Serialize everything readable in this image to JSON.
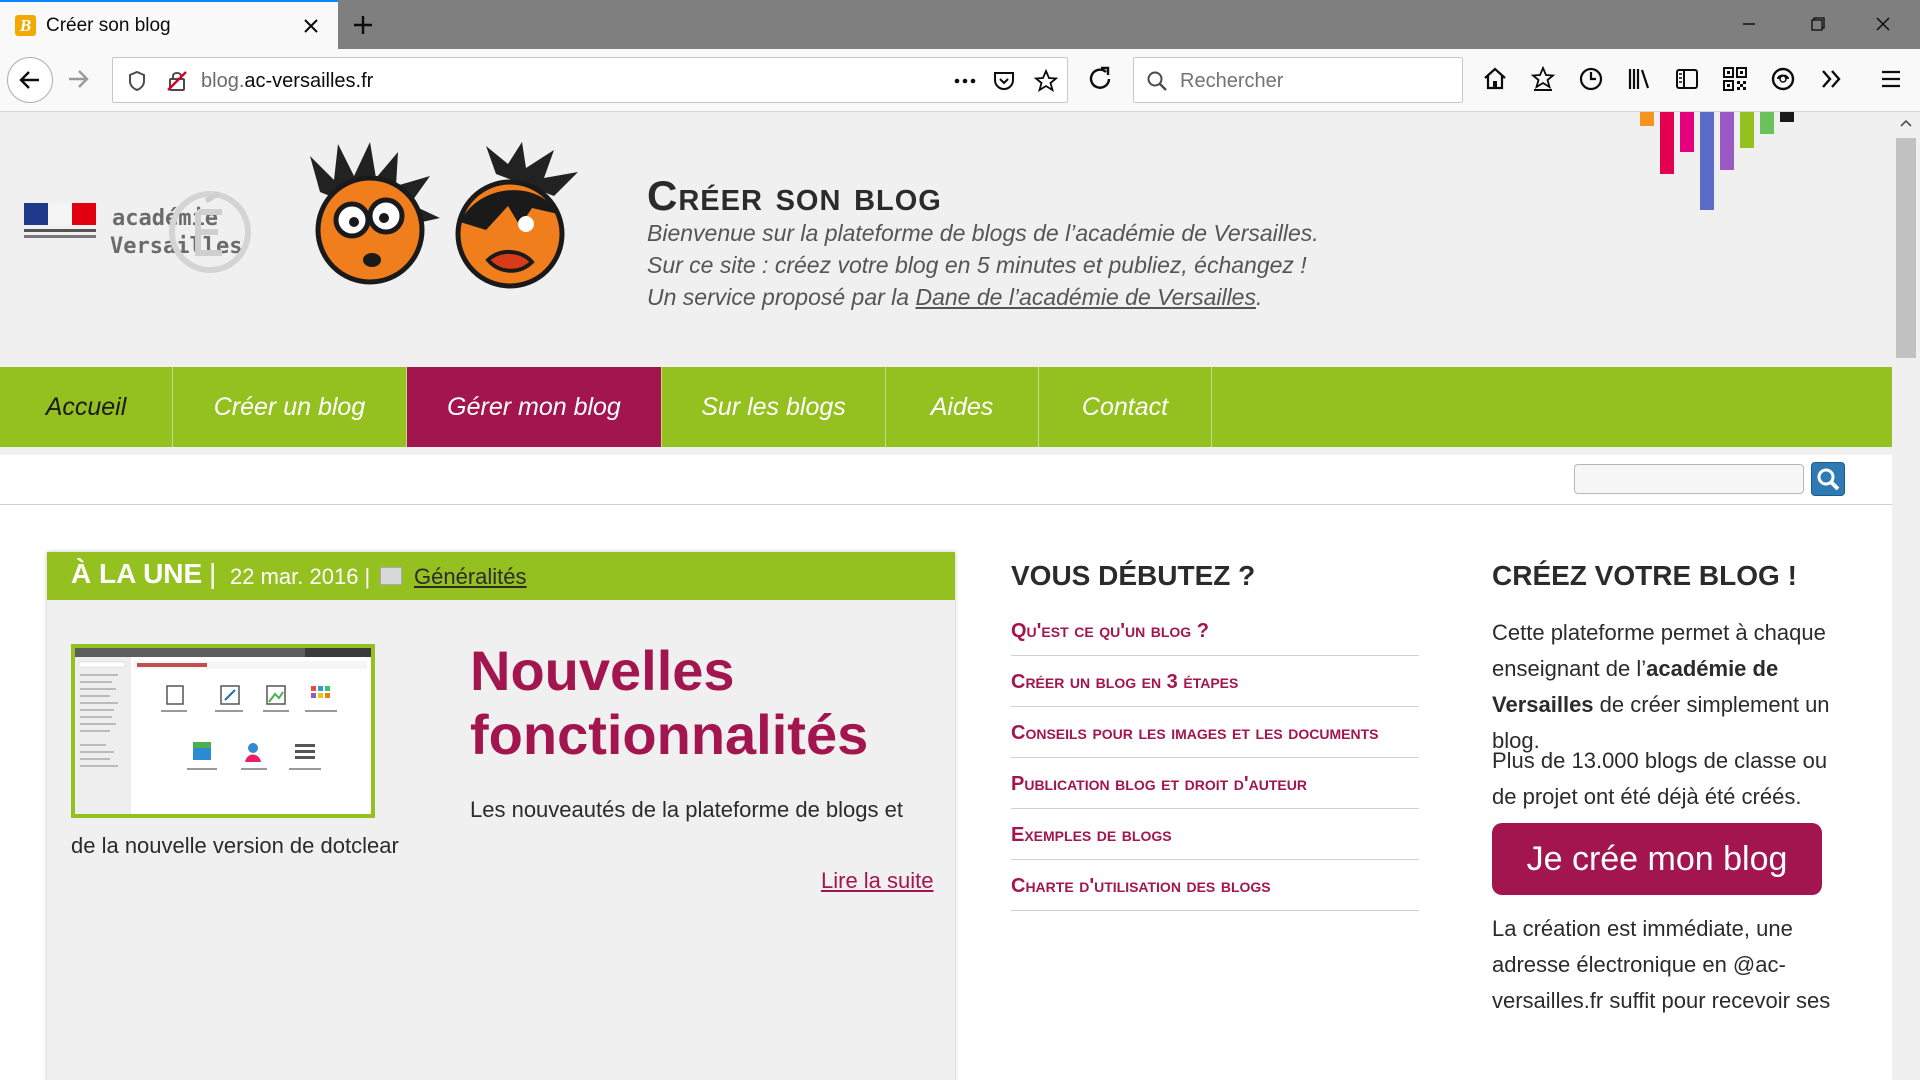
{
  "browser": {
    "tab_title": "Créer son blog",
    "favicon_letter": "B",
    "url_prefix": "blog.",
    "url_domain": "ac-versailles.fr",
    "search_placeholder": "Rechercher",
    "accent": "#0a84ff"
  },
  "header": {
    "logo_text_1": "académie",
    "logo_text_2": "Versailles",
    "title": "Créer son blog",
    "tagline_1": "Bienvenue sur la plateforme de blogs de l’académie de Versailles.",
    "tagline_2": "Sur ce site : créez votre blog en 5 minutes et publiez, échangez !",
    "tagline_3_prefix": "Un service proposé par la ",
    "tagline_3_link": "Dane de l’académie de Versailles",
    "tagline_3_suffix": "."
  },
  "menu": {
    "items": [
      {
        "label": "Accueil"
      },
      {
        "label": "Créer un blog"
      },
      {
        "label": "Gérer mon blog"
      },
      {
        "label": "Sur les blogs"
      },
      {
        "label": "Aides"
      },
      {
        "label": "Contact"
      }
    ],
    "active": "Gérer mon blog"
  },
  "article": {
    "section": "À LA UNE",
    "separator": "|",
    "date": "22 mar. 2016 |",
    "category": "Généralités",
    "title": "Nouvelles fonctionnalités",
    "excerpt_1": "Les nouveautés de la plateforme de blogs et",
    "excerpt_2": "de la nouvelle version de dotclear",
    "read_more": "Lire la suite"
  },
  "sidebar_mid": {
    "title": "VOUS DÉBUTEZ ?",
    "links": [
      {
        "label": "Qu'est ce qu'un blog ?"
      },
      {
        "label": "Créer un blog en 3 étapes"
      },
      {
        "label": "Conseils pour les images et les documents"
      },
      {
        "label": "Publication blog et droit d'auteur"
      },
      {
        "label": "Exemples de blogs"
      },
      {
        "label": "Charte d'utilisation des blogs"
      }
    ]
  },
  "sidebar_right": {
    "title": "CRÉEZ VOTRE BLOG !",
    "p1_a": "Cette plateforme permet à chaque enseignant de l’",
    "p1_b": "académie de Versailles",
    "p1_c": " de créer simplement un blog.",
    "p2": "Plus de 13.000 blogs de classe ou de projet ont été déjà été créés.",
    "cta": "Je crée mon blog",
    "p3": "La création est immédiate, une adresse électronique en @ac-versailles.fr suffit pour recevoir ses"
  },
  "colors": {
    "green": "#94c120",
    "magenta": "#a3154f",
    "page_bg": "#f0f0f0"
  }
}
